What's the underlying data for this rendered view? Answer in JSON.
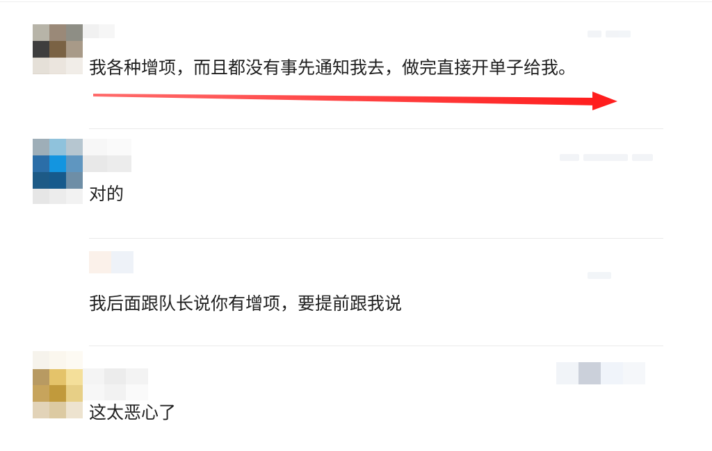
{
  "comments": [
    {
      "text": "我各种增项，而且都没有事先通知我去，做完直接开单子给我。",
      "highlight_arrow_color": "#ff2a2a"
    },
    {
      "text": "对的"
    },
    {
      "text": "我后面跟队长说你有增项，要提前跟我说"
    },
    {
      "text": "这太恶心了"
    }
  ],
  "colors": {
    "divider": "#e9e9e9",
    "text": "#1f1f1f",
    "arrow": "#ff2a2a"
  },
  "avatars": [
    {
      "pixels": [
        "#b7b4a8",
        "#9a8978",
        "#8e8e85",
        "#3e3e3e",
        "#7a6244",
        "#a89a88",
        "#ddd6cc",
        "#e6dfd6",
        "#efeae4"
      ]
    },
    {
      "pixels": [
        "#9eaeb8",
        "#8fc2dc",
        "#b6c6d0",
        "#2b6ea8",
        "#1395e0",
        "#5f96c0",
        "#1d5a86",
        "#165a8c",
        "#6e8ea6"
      ]
    },
    {
      "pixels": [
        "#b89a62",
        "#e4c36a",
        "#f4df9a",
        "#c7a45c",
        "#c19a3c",
        "#e7cf86",
        "#e2d3b8",
        "#dccaa2",
        "#ede3cf"
      ]
    }
  ],
  "reply_avatar": {
    "pixels": [
      "#fbf1ea",
      "#eef2f8"
    ]
  }
}
